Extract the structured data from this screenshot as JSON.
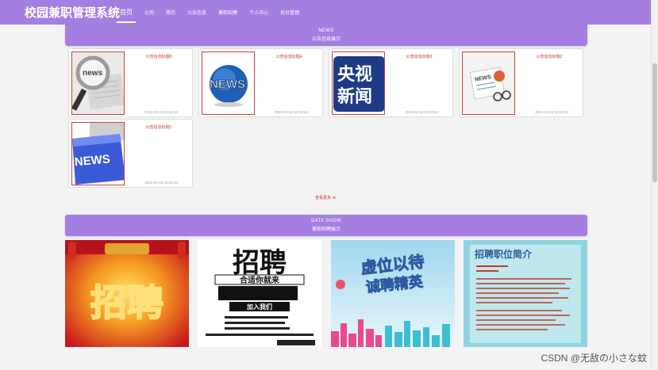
{
  "nav": {
    "brand": "校园兼职管理系统",
    "items": [
      "首页",
      "公司",
      "简历",
      "公告信息",
      "兼职招聘",
      "个人中心",
      "后台管理"
    ]
  },
  "news": {
    "section_en": "NEWS",
    "section_zh": "公告信息展示",
    "items": [
      {
        "title": "公告信息标题5",
        "time": "2022-02-23 20:53:24"
      },
      {
        "title": "公告信息标题4",
        "time": "2022-02-23 20:53:24"
      },
      {
        "title": "公告信息标题3",
        "time": "2022-02-23 20:53:24"
      },
      {
        "title": "公告信息标题2",
        "time": "2022-02-23 20:53:24"
      },
      {
        "title": "公告信息标题1",
        "time": "2022-02-23 20:53:24"
      }
    ],
    "view_more": "查看更多 ≫"
  },
  "data_show": {
    "section_en": "DATA SHOW",
    "section_zh": "兼职招聘展示",
    "banners": [
      {
        "text": "招聘"
      },
      {
        "text": "招聘",
        "sub": "合适你就来",
        "join": "加入我们"
      },
      {
        "text": "虚位以待",
        "sub": "诚聘精英"
      },
      {
        "text": "招聘职位简介"
      }
    ]
  },
  "thumbs": {
    "t1": "news",
    "t2": "NEWS",
    "t3_top": "央视",
    "t3_bottom": "新闻",
    "t4": "NEWS",
    "t5": "NEWS"
  },
  "watermark": "CSDN @无敌の小さな蚊"
}
